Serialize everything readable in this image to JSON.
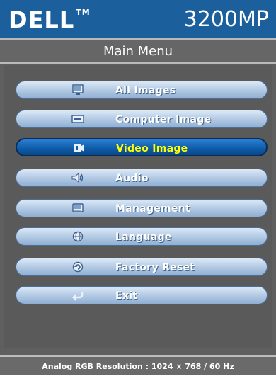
{
  "header": {
    "brand": "DELL",
    "trademark": "TM",
    "model": "3200MP",
    "color": "#1b5f9d"
  },
  "menu": {
    "title": "Main Menu",
    "selected_index": 2,
    "items": [
      {
        "label": "All Images",
        "icon": "all-images-icon"
      },
      {
        "label": "Computer Image",
        "icon": "computer-image-icon"
      },
      {
        "label": "Video Image",
        "icon": "video-image-icon"
      },
      {
        "label": "Audio",
        "icon": "speaker-icon"
      },
      {
        "label": "Management",
        "icon": "management-icon"
      },
      {
        "label": "Language",
        "icon": "language-icon"
      },
      {
        "label": "Factory Reset",
        "icon": "factory-reset-icon"
      },
      {
        "label": "Exit",
        "icon": "exit-arrow-icon"
      }
    ],
    "selected_label_color": "#ffff00"
  },
  "status": {
    "text": "Analog RGB Resolution : 1024 × 768 / 60 Hz"
  }
}
